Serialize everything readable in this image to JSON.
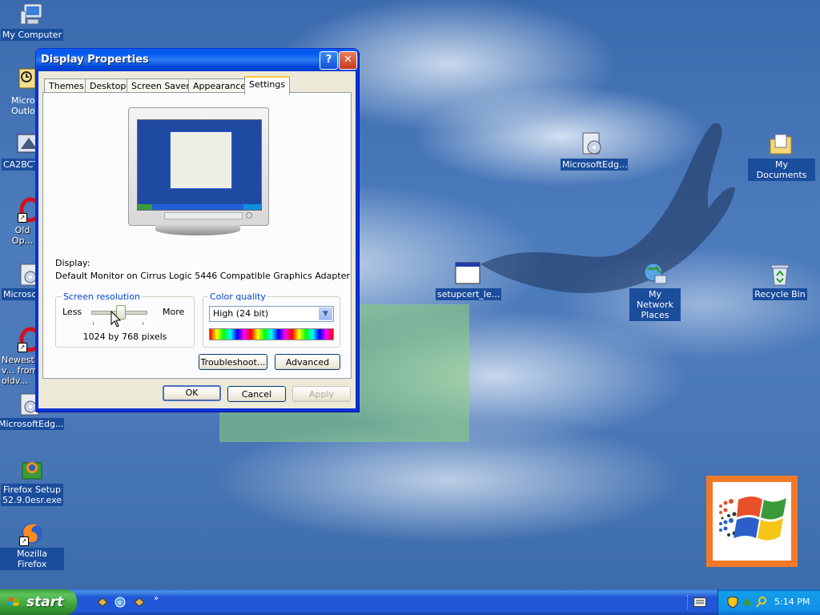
{
  "desktop": {
    "icons": [
      {
        "label": "My Computer"
      },
      {
        "label": "Micros... Outlo..."
      },
      {
        "label": "CA2BCTI..."
      },
      {
        "label": "Old Op..."
      },
      {
        "label": "Microsof..."
      },
      {
        "label": "Newest v... from oldv..."
      },
      {
        "label": "MicrosoftEdg..."
      },
      {
        "label": "Firefox Setup 52.9.0esr.exe"
      },
      {
        "label": "Mozilla Firefox"
      },
      {
        "label": "MicrosoftEdg..."
      },
      {
        "label": "My Documents"
      },
      {
        "label": "setupcert_le..."
      },
      {
        "label": "My Network Places"
      },
      {
        "label": "Recycle Bin"
      }
    ]
  },
  "dialog": {
    "title": "Display Properties",
    "help_glyph": "?",
    "close_glyph": "✕",
    "tabs": [
      {
        "label": "Themes"
      },
      {
        "label": "Desktop"
      },
      {
        "label": "Screen Saver"
      },
      {
        "label": "Appearance"
      },
      {
        "label": "Settings"
      }
    ],
    "active_tab": "Settings",
    "display_label": "Display:",
    "display_value": "Default Monitor on Cirrus Logic 5446 Compatible Graphics Adapter",
    "resolution": {
      "group_title": "Screen resolution",
      "less_label": "Less",
      "more_label": "More",
      "value_text": "1024 by 768 pixels",
      "slider_level": 0.5
    },
    "color_quality": {
      "group_title": "Color quality",
      "selected": "High (24 bit)"
    },
    "buttons": {
      "troubleshoot": "Troubleshoot...",
      "advanced": "Advanced",
      "ok": "OK",
      "cancel": "Cancel",
      "apply": "Apply"
    }
  },
  "taskbar": {
    "start_label": "start",
    "quick_launch_more": "»",
    "clock": "5:14 PM"
  },
  "colors": {
    "title_bar": "#0058ee",
    "start_button": "#3c9e3a",
    "taskbar": "#2157d7",
    "tray": "#1290e8",
    "group_title": "#0046d5",
    "logo_frame": "#f07a28"
  }
}
